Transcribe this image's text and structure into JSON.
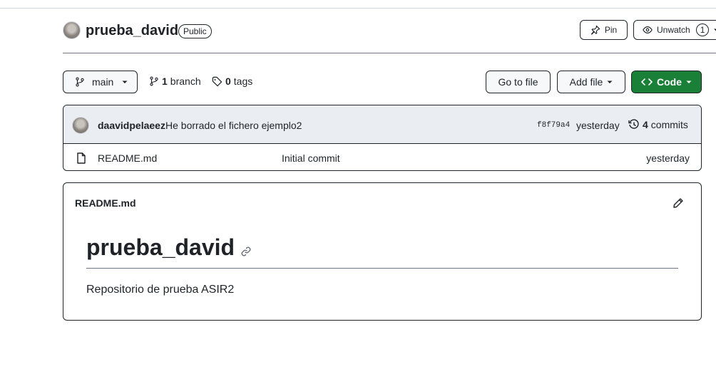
{
  "repo": {
    "name": "prueba_david",
    "visibility": "Public",
    "pin_label": "Pin",
    "watch_label": "Unwatch",
    "watch_count": "1"
  },
  "toolbar": {
    "branch": "main",
    "branch_count": "1",
    "branch_label": "branch",
    "tag_count": "0",
    "tag_label": "tags",
    "goto_file": "Go to file",
    "add_file": "Add file",
    "code": "Code"
  },
  "commit": {
    "author": "daavidpelaeez",
    "message": "He borrado el fichero ejemplo2",
    "sha": "f8f79a4",
    "time": "yesterday",
    "commit_count": "4",
    "commit_label": "commits"
  },
  "files": [
    {
      "name": "README.md",
      "message": "Initial commit",
      "time": "yesterday",
      "icon": "file-icon"
    }
  ],
  "readme": {
    "filename": "README.md",
    "heading": "prueba_david",
    "body": "Repositorio de prueba ASIR2"
  },
  "colors": {
    "code_button": "#1a7f37",
    "commit_bar": "#eaeef2",
    "button_bg": "#f6f8fa"
  }
}
